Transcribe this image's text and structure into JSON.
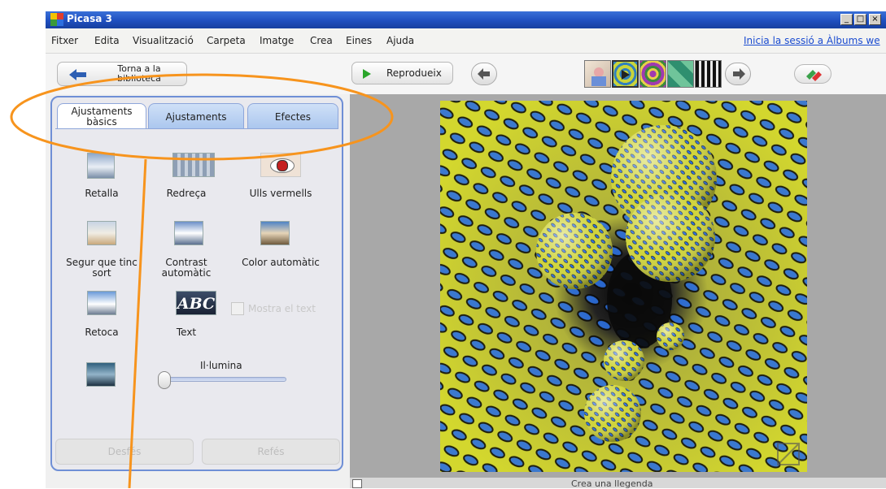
{
  "app": {
    "title": "Picasa 3"
  },
  "window_buttons": {
    "minimize": "_",
    "maximize": "□",
    "close": "×"
  },
  "menu": {
    "items": [
      "Fitxer",
      "Edita",
      "Visualització",
      "Carpeta",
      "Imatge",
      "Crea",
      "Eines",
      "Ajuda"
    ],
    "signin": "Inicia la sessió a Àlbums we"
  },
  "toolbar": {
    "back_label_line1": "Torna a la",
    "back_label_line2": "biblioteca",
    "play_label": "Reprodueix"
  },
  "tabs": {
    "basic_line1": "Ajustaments",
    "basic_line2": "bàsics",
    "tuning": "Ajustaments",
    "effects": "Efectes"
  },
  "tools": {
    "crop": "Retalla",
    "straighten": "Redreça",
    "redeye": "Ulls vermells",
    "feeling_lucky_line1": "Segur que tinc",
    "feeling_lucky_line2": "sort",
    "auto_contrast_line1": "Contrast",
    "auto_contrast_line2": "automàtic",
    "auto_color": "Color automàtic",
    "retouch": "Retoca",
    "text": "Text",
    "text_icon": "ABC",
    "show_text": "Mostra el text"
  },
  "fill_light": {
    "label": "Il·lumina",
    "value": 0
  },
  "actions": {
    "undo": "Desfés",
    "redo": "Refés"
  },
  "caption": {
    "placeholder": "Crea una llegenda"
  },
  "colors": {
    "highlight": "#f7941d",
    "titlebar": "#1f4fbf",
    "panel_border": "#6f8fd6"
  },
  "icons": [
    "app-icon",
    "back-arrow-icon",
    "play-icon",
    "prev-arrow-icon",
    "next-arrow-icon",
    "share-icon",
    "checkbox-icon",
    "slider-handle-icon"
  ]
}
